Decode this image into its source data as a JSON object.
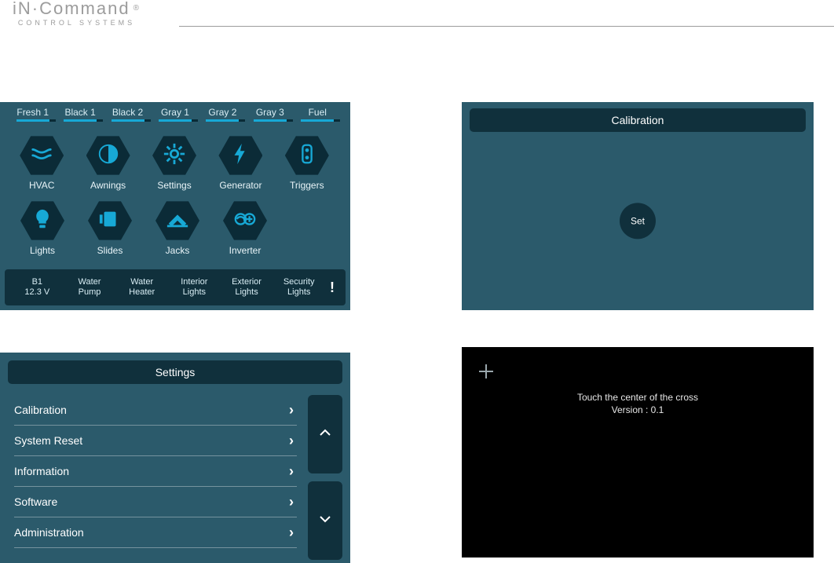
{
  "logo": {
    "main": "iN·Command",
    "sub": "CONTROL SYSTEMS",
    "reg": "®"
  },
  "home": {
    "tanks": [
      "Fresh 1",
      "Black 1",
      "Black 2",
      "Gray 1",
      "Gray 2",
      "Gray 3",
      "Fuel"
    ],
    "hex_row1": [
      {
        "label": "HVAC",
        "icon": "hvac"
      },
      {
        "label": "Awnings",
        "icon": "awnings"
      },
      {
        "label": "Settings",
        "icon": "settings"
      },
      {
        "label": "Generator",
        "icon": "generator"
      },
      {
        "label": "Triggers",
        "icon": "triggers"
      }
    ],
    "hex_row2": [
      {
        "label": "Lights",
        "icon": "lights"
      },
      {
        "label": "Slides",
        "icon": "slides"
      },
      {
        "label": "Jacks",
        "icon": "jacks"
      },
      {
        "label": "Inverter",
        "icon": "inverter"
      }
    ],
    "bottom": {
      "battery_label": "B1",
      "battery_value": "12.3 V",
      "items": [
        "Water\nPump",
        "Water\nHeater",
        "Interior\nLights",
        "Exterior\nLights",
        "Security\nLights"
      ],
      "alert": "!"
    }
  },
  "calibration": {
    "title": "Calibration",
    "set": "Set"
  },
  "settings": {
    "title": "Settings",
    "items": [
      "Calibration",
      "System Reset",
      "Information",
      "Software",
      "Administration"
    ]
  },
  "touchcal": {
    "line1": "Touch the center of the cross",
    "line2": "Version : 0.1"
  },
  "colors": {
    "panel_bg": "#2b5a6b",
    "dark_bg": "#10303c",
    "accent": "#17a9d6"
  }
}
